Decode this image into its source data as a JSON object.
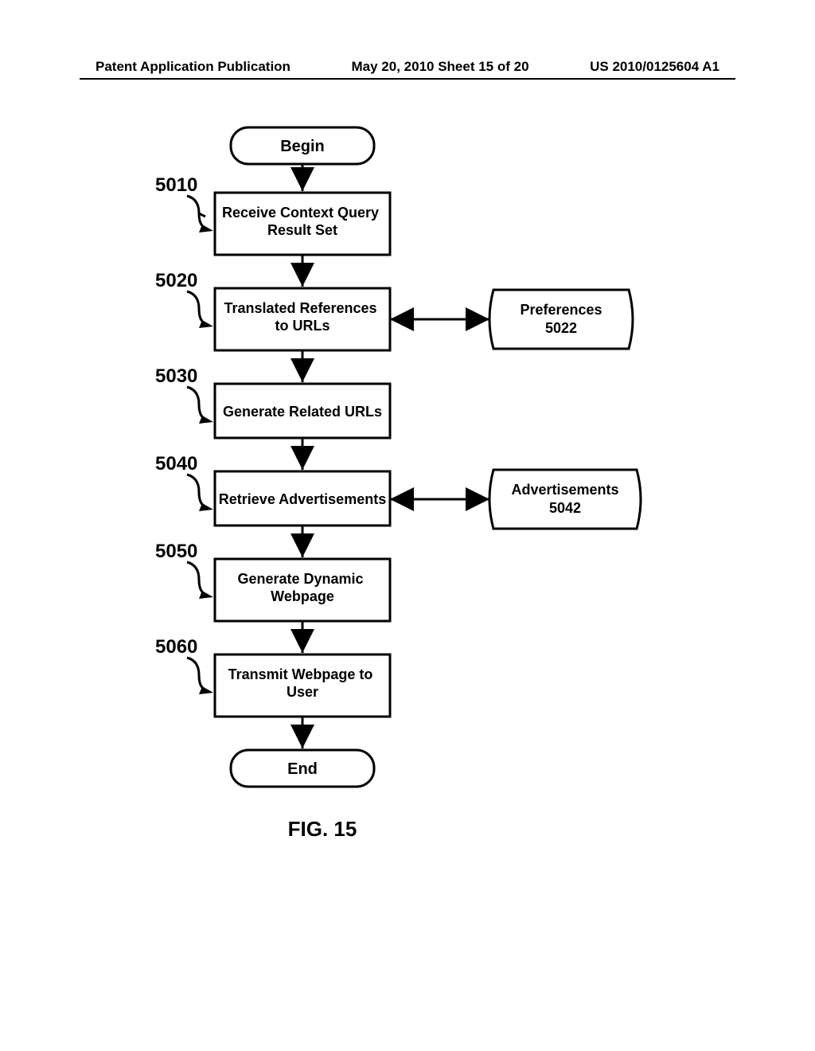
{
  "header": {
    "left": "Patent Application Publication",
    "center": "May 20, 2010  Sheet 15 of 20",
    "right": "US 2010/0125604 A1"
  },
  "caption": "FIG. 15",
  "flow": {
    "begin": "Begin",
    "end": "End",
    "refs": [
      "5010",
      "5020",
      "5030",
      "5040",
      "5050",
      "5060"
    ],
    "steps": [
      "Receive Context Query Result Set",
      "Translated References to URLs",
      "Generate Related URLs",
      "Retrieve Advertisements",
      "Generate Dynamic Webpage",
      "Transmit Webpage to User"
    ],
    "side": {
      "prefs": {
        "label": "Preferences",
        "ref": "5022"
      },
      "ads": {
        "label": "Advertisements",
        "ref": "5042"
      }
    }
  }
}
